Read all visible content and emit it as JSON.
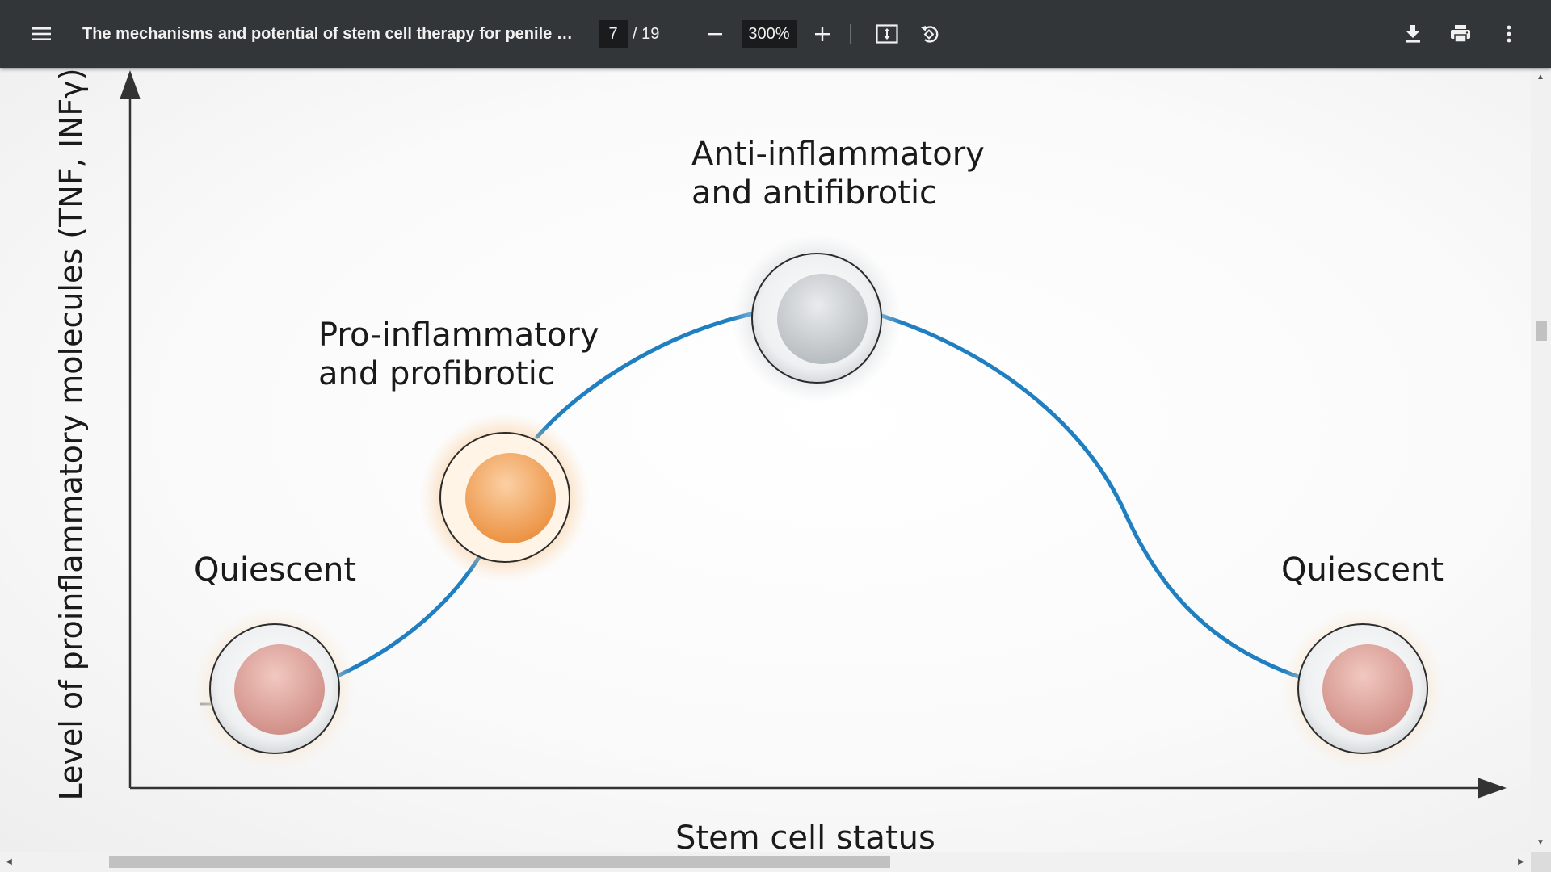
{
  "toolbar": {
    "title": "The mechanisms and potential of stem cell therapy for penile fi...",
    "current_page": "7",
    "page_total": "/ 19",
    "zoom": "300%",
    "icons": [
      "menu-icon",
      "zoom-out-icon",
      "zoom-in-icon",
      "fit-page-icon",
      "rotate-icon",
      "download-icon",
      "print-icon",
      "more-vert-icon"
    ]
  },
  "figure": {
    "y_axis_label": "Level of proinflammatory molecules (TNF, INFγ)",
    "x_axis_label": "Stem cell status",
    "states": [
      {
        "label_line1": "Quiescent",
        "label_line2": "",
        "color": "#d9a09a"
      },
      {
        "label_line1": "Pro-inflammatory",
        "label_line2": "and profibrotic",
        "color": "#f0a15c"
      },
      {
        "label_line1": "Anti-inflammatory",
        "label_line2": "and antifibrotic",
        "color": "#c9cdd0"
      },
      {
        "label_line1": "Quiescent",
        "label_line2": "",
        "color": "#d9a09a"
      }
    ],
    "curve_color": "#1f7fc0"
  }
}
